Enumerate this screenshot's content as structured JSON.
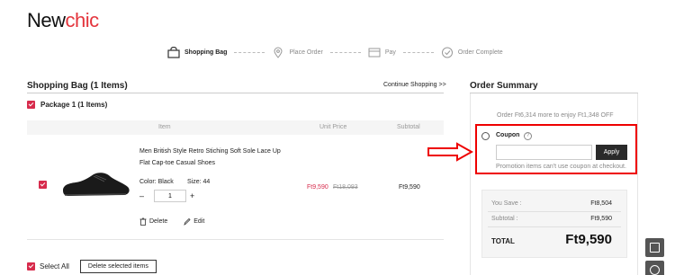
{
  "brand": {
    "part1": "New",
    "part2": "chic"
  },
  "steps": [
    {
      "label": "Shopping Bag",
      "icon": "bag-icon",
      "active": true
    },
    {
      "label": "Place Order",
      "icon": "location-pin-icon",
      "active": false
    },
    {
      "label": "Pay",
      "icon": "card-icon",
      "active": false
    },
    {
      "label": "Order Complete",
      "icon": "check-circle-icon",
      "active": false
    }
  ],
  "bag": {
    "title": "Shopping Bag (1 Items)",
    "continue": "Continue Shopping >>",
    "package": "Package 1 (1 Items)",
    "columns": {
      "item": "Item",
      "unit_price": "Unit Price",
      "subtotal": "Subtotal"
    },
    "item": {
      "name": "Men British Style Retro Stiching Soft Sole Lace Up Flat Cap-toe Casual Shoes",
      "color": "Color: Black",
      "size": "Size: 44",
      "qty": "1",
      "price": "Ft9,590",
      "old_price": "Ft18,093",
      "subtotal": "Ft9,590",
      "delete": "Delete",
      "edit": "Edit"
    },
    "select_all": "Select All",
    "delete_selected": "Delete selected items"
  },
  "summary": {
    "title": "Order Summary",
    "promo": "Order Ft6,314 more to enjoy Ft1,348 OFF",
    "coupon_label": "Coupon",
    "coupon_help": "?",
    "coupon_placeholder": "",
    "apply": "Apply",
    "coupon_note": "Promotion items can't use coupon at checkout.",
    "you_save_label": "You Save :",
    "you_save": "Ft8,504",
    "subtotal_label": "Subtotal :",
    "subtotal": "Ft9,590",
    "total_label": "TOTAL",
    "total": "Ft9,590"
  },
  "colors": {
    "accent": "#d72b4c",
    "highlight": "#ee0000",
    "dark": "#2a2a2a"
  }
}
